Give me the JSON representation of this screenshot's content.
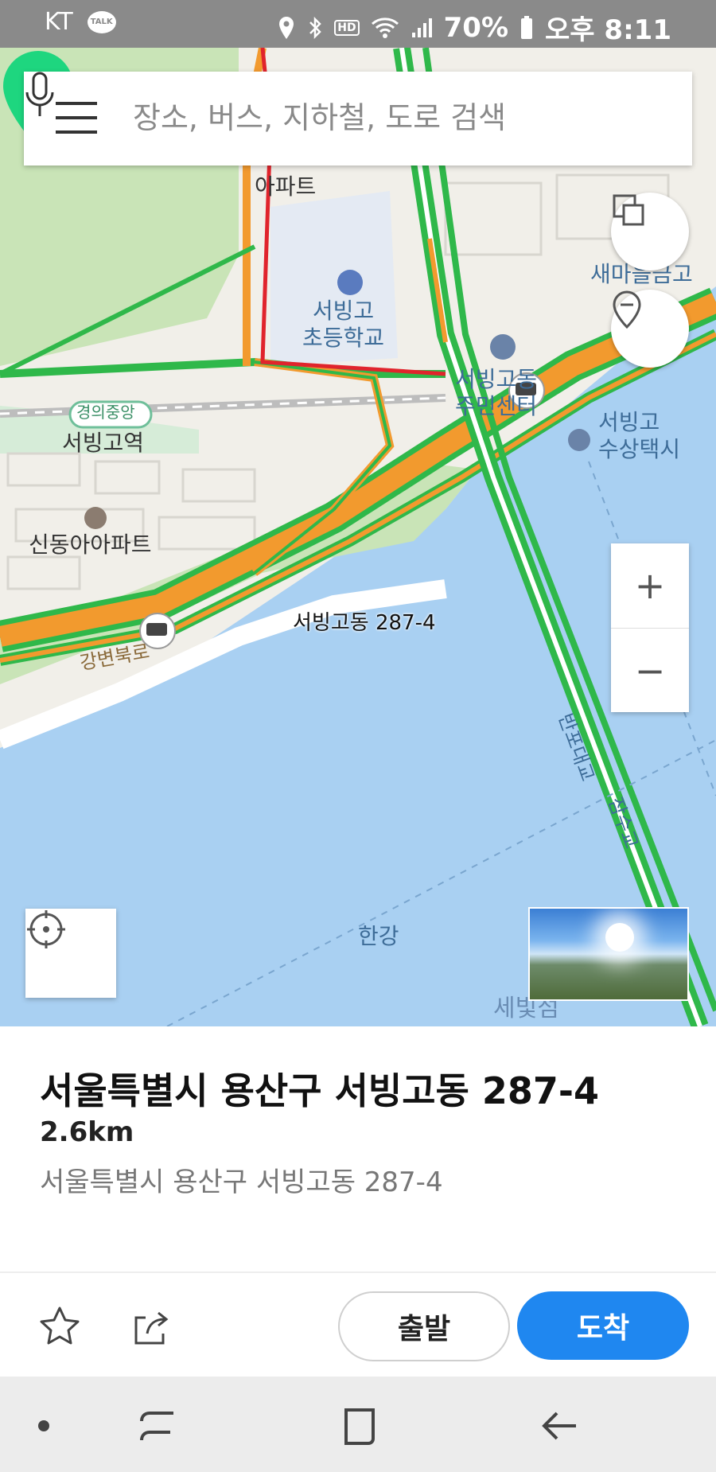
{
  "status_bar": {
    "carrier": "KT",
    "talk_icon_text": "TALK",
    "hd_text": "HD",
    "battery": "70%",
    "time": "오후 8:11"
  },
  "search": {
    "placeholder": "장소, 버스, 지하철, 도로 검색"
  },
  "map": {
    "labels": {
      "apartment_top": "아파트",
      "school": "서빙고\n초등학교",
      "community_center": "서빙고동\n주민센터",
      "bank": "새마을금고",
      "line_badge": "경의중앙",
      "station": "서빙고역",
      "water_taxi": "서빙고\n수상택시",
      "shindong_apt": "신동아아파트",
      "road": "강변북로",
      "bridge": "반포대교",
      "bridge2": "잠수교",
      "pin_label": "서빙고동 287-4",
      "river": "한강",
      "island": "세빛섬"
    },
    "zoom_in": "+",
    "zoom_out": "−",
    "colors": {
      "water": "#a9d0f2",
      "land": "#f1efe9",
      "green_area": "#c9e4b7",
      "road_green": "#2fb84a",
      "road_orange": "#f29a2e",
      "road_red": "#e0242c",
      "pin": "#1ed67f"
    }
  },
  "place": {
    "title": "서울특별시 용산구 서빙고동 287-4",
    "distance": "2.6km",
    "address": "서울특별시 용산구 서빙고동 287-4"
  },
  "actions": {
    "depart_label": "출발",
    "arrive_label": "도착"
  },
  "icons": [
    "hamburger-icon",
    "mic-icon",
    "layers-icon",
    "location-pin-icon",
    "zoom-in-icon",
    "zoom-out-icon",
    "crosshair-icon",
    "star-icon",
    "share-icon",
    "back-icon",
    "home-icon",
    "recent-icon"
  ]
}
